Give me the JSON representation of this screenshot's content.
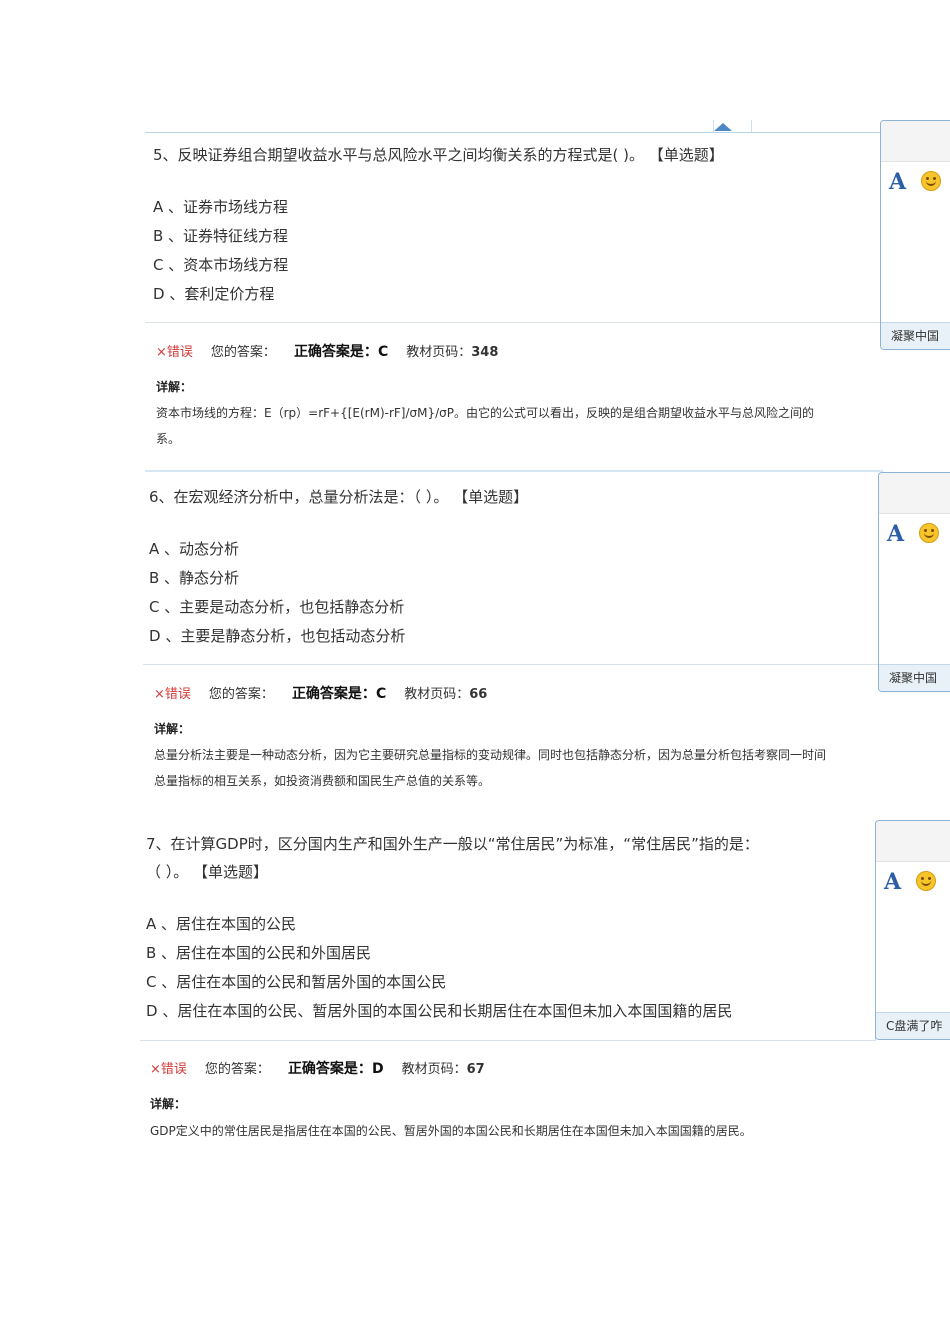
{
  "questions": [
    {
      "title": "5、反映证券组合期望收益水平与总风险水平之间均衡关系的方程式是(  )。   【单选题】",
      "options": [
        "A 、证券市场线方程",
        "B 、证券特征线方程",
        "C 、资本市场线方程",
        "D 、套利定价方程"
      ],
      "result": {
        "mark": "×",
        "status": "错误",
        "your_answer_label": "您的答案：",
        "correct_label": "正确答案是：",
        "correct_value": "C",
        "page_label": "教材页码：",
        "page_value": "348"
      },
      "detail_label": "详解：",
      "detail_lines": [
        "资本市场线的方程：E（rp）=rF+{[E(rM)-rF]/σM}/σP。由它的公式可以看出，反映的是组合期望收益水平与总风险之间的",
        "系。"
      ],
      "panel_footer": "凝聚中国"
    },
    {
      "title": "6、在宏观经济分析中，总量分析法是：（  ）。  【单选题】",
      "options": [
        "A 、动态分析",
        "B 、静态分析",
        "C 、主要是动态分析，也包括静态分析",
        "D 、主要是静态分析，也包括动态分析"
      ],
      "result": {
        "mark": "×",
        "status": "错误",
        "your_answer_label": "您的答案：",
        "correct_label": "正确答案是：",
        "correct_value": "C",
        "page_label": "教材页码：",
        "page_value": "66"
      },
      "detail_label": "详解：",
      "detail_lines": [
        "总量分析法主要是一种动态分析，因为它主要研究总量指标的变动规律。同时也包括静态分析，因为总量分析包括考察同一时间",
        "总量指标的相互关系，如投资消费额和国民生产总值的关系等。"
      ],
      "panel_footer": "凝聚中国"
    },
    {
      "title": "7、在计算GDP时，区分国内生产和国外生产一般以“常住居民”为标准，“常住居民”指的是：",
      "title_line2": "（  ）。  【单选题】",
      "options": [
        "A 、居住在本国的公民",
        "B 、居住在本国的公民和外国居民",
        "C 、居住在本国的公民和暂居外国的本国公民",
        "D 、居住在本国的公民、暂居外国的本国公民和长期居住在本国但未加入本国国籍的居民"
      ],
      "result": {
        "mark": "×",
        "status": "错误",
        "your_answer_label": "您的答案：",
        "correct_label": "正确答案是：",
        "correct_value": "D",
        "page_label": "教材页码：",
        "page_value": "67"
      },
      "detail_label": "详解：",
      "detail_lines": [
        "GDP定义中的常住居民是指居住在本国的公民、暂居外国的本国公民和长期居住在本国但未加入本国国籍的居民。"
      ],
      "panel_footer": "C盘满了咋"
    }
  ],
  "panel": {
    "font_icon_glyph": "A"
  }
}
